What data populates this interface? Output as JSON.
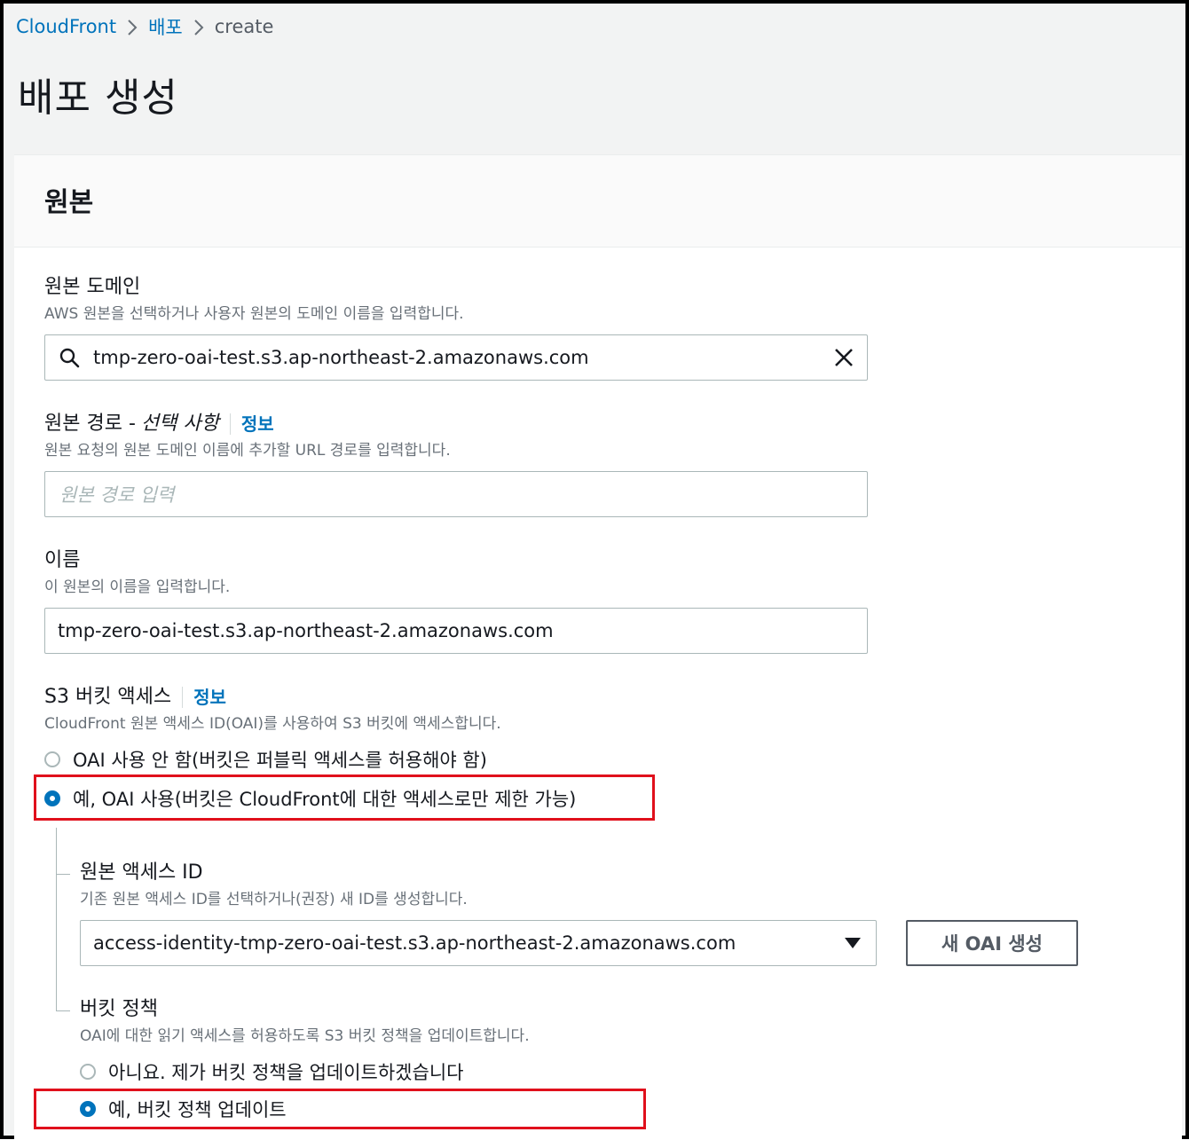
{
  "breadcrumb": {
    "items": [
      {
        "label": "CloudFront"
      },
      {
        "label": "배포"
      },
      {
        "label": "create"
      }
    ]
  },
  "page": {
    "title": "배포 생성"
  },
  "origin": {
    "header": "원본",
    "domain": {
      "label": "원본 도메인",
      "description": "AWS 원본을 선택하거나 사용자 원본의 도메인 이름을 입력합니다.",
      "value": "tmp-zero-oai-test.s3.ap-northeast-2.amazonaws.com"
    },
    "path": {
      "label": "원본 경로 -",
      "optional": "선택 사항",
      "info": "정보",
      "description": "원본 요청의 원본 도메인 이름에 추가할 URL 경로를 입력합니다.",
      "placeholder": "원본 경로 입력"
    },
    "name": {
      "label": "이름",
      "description": "이 원본의 이름을 입력합니다.",
      "value": "tmp-zero-oai-test.s3.ap-northeast-2.amazonaws.com"
    },
    "s3_access": {
      "label": "S3 버킷 액세스",
      "info": "정보",
      "description": "CloudFront 원본 액세스 ID(OAI)를 사용하여 S3 버킷에 액세스합니다.",
      "options": [
        {
          "label": "OAI 사용 안 함(버킷은 퍼블릭 액세스를 허용해야 함)",
          "checked": false
        },
        {
          "label": "예, OAI 사용(버킷은 CloudFront에 대한 액세스로만 제한 가능)",
          "checked": true
        }
      ]
    },
    "oai": {
      "label": "원본 액세스 ID",
      "description": "기존 원본 액세스 ID를 선택하거나(권장) 새 ID를 생성합니다.",
      "selected": "access-identity-tmp-zero-oai-test.s3.ap-northeast-2.amazonaws.com",
      "create_button": "새 OAI 생성"
    },
    "bucket_policy": {
      "label": "버킷 정책",
      "description": "OAI에 대한 읽기 액세스를 허용하도록 S3 버킷 정책을 업데이트합니다.",
      "options": [
        {
          "label": "아니요. 제가 버킷 정책을 업데이트하겠습니다",
          "checked": false
        },
        {
          "label": "예, 버킷 정책 업데이트",
          "checked": true
        }
      ]
    }
  },
  "colors": {
    "link": "#0073bb",
    "highlight": "#e0101c",
    "radio_checked": "#0073bb"
  }
}
